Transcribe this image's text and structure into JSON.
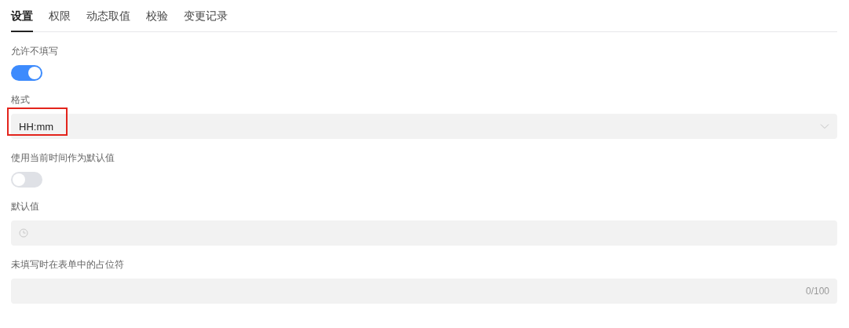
{
  "tabs": [
    {
      "label": "设置",
      "selected": true
    },
    {
      "label": "权限",
      "selected": false
    },
    {
      "label": "动态取值",
      "selected": false
    },
    {
      "label": "校验",
      "selected": false
    },
    {
      "label": "变更记录",
      "selected": false
    }
  ],
  "fields": [
    {
      "kind": "toggle",
      "label": "允许不填写",
      "on": true
    },
    {
      "kind": "select",
      "label": "格式",
      "value": "HH:mm",
      "highlighted": true
    },
    {
      "kind": "toggle",
      "label": "使用当前时间作为默认值",
      "on": false
    },
    {
      "kind": "time",
      "label": "默认值"
    },
    {
      "kind": "text",
      "label": "未填写时在表单中的占位符",
      "counter": "0/100"
    }
  ]
}
